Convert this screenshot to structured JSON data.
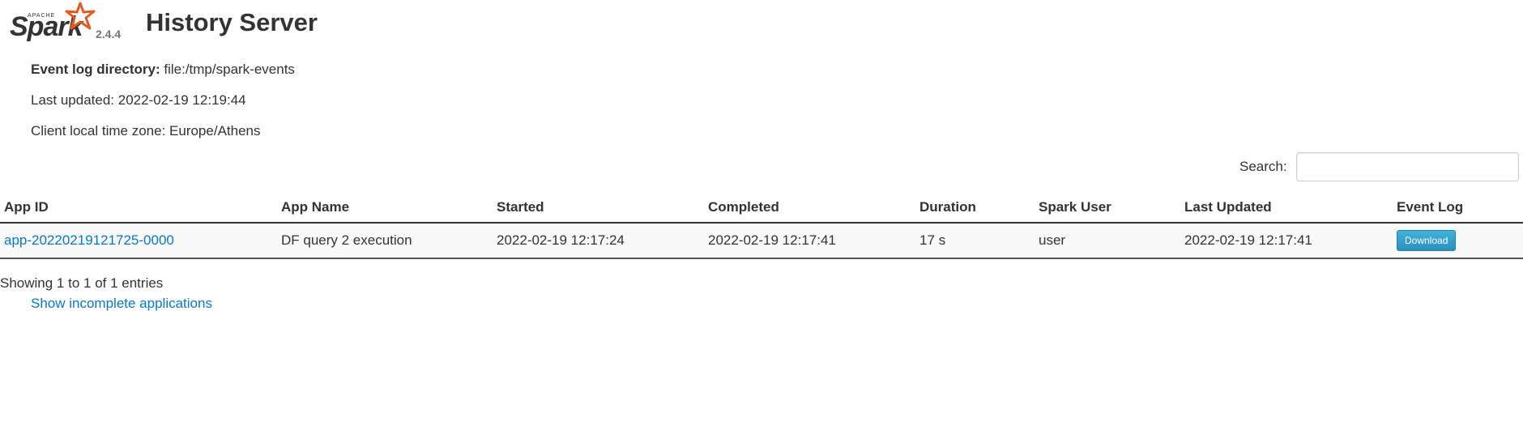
{
  "header": {
    "logo_apache": "APACHE",
    "logo_spark": "Spark",
    "version": "2.4.4",
    "title": "History Server"
  },
  "info": {
    "event_log_label": "Event log directory:",
    "event_log_value": "file:/tmp/spark-events",
    "last_updated": "Last updated: 2022-02-19 12:19:44",
    "timezone": "Client local time zone: Europe/Athens"
  },
  "search": {
    "label": "Search:",
    "value": ""
  },
  "table": {
    "columns": [
      "App ID",
      "App Name",
      "Started",
      "Completed",
      "Duration",
      "Spark User",
      "Last Updated",
      "Event Log"
    ],
    "rows": [
      {
        "app_id": "app-20220219121725-0000",
        "app_name": "DF query 2 execution",
        "started": "2022-02-19 12:17:24",
        "completed": "2022-02-19 12:17:41",
        "duration": "17 s",
        "spark_user": "user",
        "last_updated": "2022-02-19 12:17:41",
        "event_log": "Download"
      }
    ]
  },
  "footer": {
    "showing": "Showing 1 to 1 of 1 entries",
    "show_incomplete": "Show incomplete applications"
  },
  "colors": {
    "link": "#0a78c8",
    "logo_star": "#e25a1c",
    "download_button": "#2a8fbf"
  }
}
